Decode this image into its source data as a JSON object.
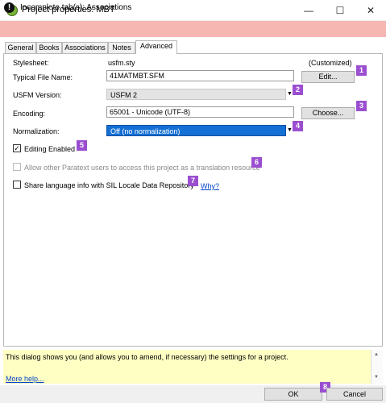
{
  "window": {
    "title": "Project properties: MBT",
    "minimize_label": "—",
    "maximize_label": "☐",
    "close_label": "✕"
  },
  "warning": {
    "icon_glyph": "!",
    "text": "Incomplete tab(s): Associations"
  },
  "tabs": [
    {
      "label": "General"
    },
    {
      "label": "Books"
    },
    {
      "label": "Associations"
    },
    {
      "label": "Notes"
    },
    {
      "label": "Advanced"
    }
  ],
  "advanced": {
    "stylesheet_label": "Stylesheet:",
    "stylesheet_value": "usfm.sty",
    "customized_label": "(Customized)",
    "typical_file_label": "Typical File Name:",
    "typical_file_value": "41MATMBT.SFM",
    "edit_button": "Edit...",
    "usfm_version_label": "USFM Version:",
    "usfm_version_value": "USFM 2",
    "encoding_label": "Encoding:",
    "encoding_value": "65001 - Unicode (UTF-8)",
    "choose_button": "Choose...",
    "normalization_label": "Normalization:",
    "normalization_value": "Off (no normalization)",
    "editing_enabled_label": "Editing Enabled",
    "editing_enabled_checked": true,
    "allow_others_label": "Allow other Paratext users to access this project as a translation resource",
    "allow_others_checked": false,
    "share_language_label": "Share language info with SIL Locale Data Repository",
    "share_language_checked": false,
    "why_link": "Why?"
  },
  "badges": [
    "1",
    "2",
    "3",
    "4",
    "5",
    "6",
    "7",
    "8"
  ],
  "help": {
    "text": "This dialog shows you (and allows you to amend, if necessary) the settings for a project.",
    "more_help": "More help..."
  },
  "buttons": {
    "ok": "OK",
    "cancel": "Cancel"
  },
  "colors": {
    "warning_bg": "#f6b7b3",
    "help_bg": "#ffffc4",
    "badge": "#9b4fd0",
    "selection": "#1470d4"
  }
}
